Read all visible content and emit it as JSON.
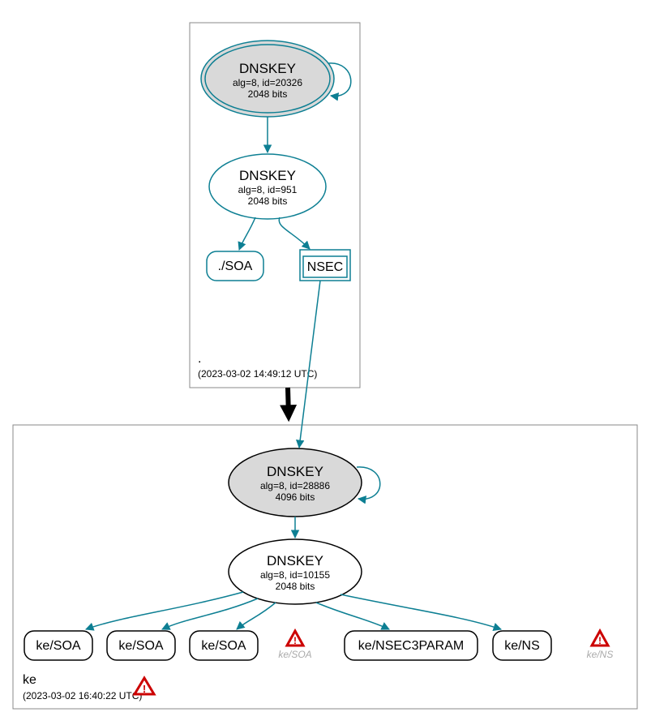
{
  "zones": {
    "root": {
      "label": ".",
      "timestamp": "(2023-03-02 14:49:12 UTC)"
    },
    "ke": {
      "label": "ke",
      "timestamp": "(2023-03-02 16:40:22 UTC)"
    }
  },
  "nodes": {
    "root_ksk": {
      "title": "DNSKEY",
      "line1": "alg=8, id=20326",
      "line2": "2048 bits"
    },
    "root_zsk": {
      "title": "DNSKEY",
      "line1": "alg=8, id=951",
      "line2": "2048 bits"
    },
    "root_soa": {
      "label": "./SOA"
    },
    "root_nsec": {
      "label": "NSEC"
    },
    "ke_ksk": {
      "title": "DNSKEY",
      "line1": "alg=8, id=28886",
      "line2": "4096 bits"
    },
    "ke_zsk": {
      "title": "DNSKEY",
      "line1": "alg=8, id=10155",
      "line2": "2048 bits"
    },
    "ke_soa1": {
      "label": "ke/SOA"
    },
    "ke_soa2": {
      "label": "ke/SOA"
    },
    "ke_soa3": {
      "label": "ke/SOA"
    },
    "ke_soa_warn": {
      "label": "ke/SOA"
    },
    "ke_nsec3param": {
      "label": "ke/NSEC3PARAM"
    },
    "ke_ns": {
      "label": "ke/NS"
    },
    "ke_ns_warn": {
      "label": "ke/NS"
    }
  }
}
